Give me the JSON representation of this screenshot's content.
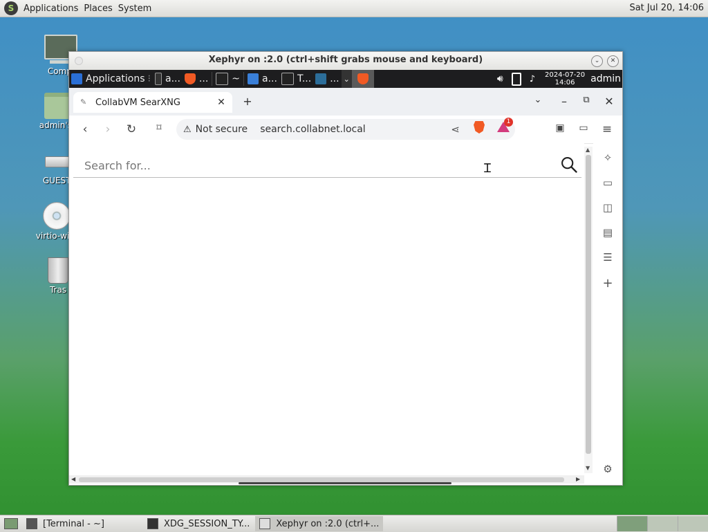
{
  "top_panel": {
    "menus": [
      "Applications",
      "Places",
      "System"
    ],
    "clock": "Sat Jul 20, 14:06"
  },
  "desktop_icons": [
    {
      "label": "Compi",
      "icon": "computer-icon"
    },
    {
      "label": "admin's I",
      "icon": "home-folder-icon"
    },
    {
      "label": "GUEST8",
      "icon": "drive-icon"
    },
    {
      "label": "virtio-win-",
      "icon": "disc-icon"
    },
    {
      "label": "Tras",
      "icon": "trash-icon"
    }
  ],
  "xephyr": {
    "title": "Xephyr on :2.0 (ctrl+shift grabs mouse and keyboard)"
  },
  "guest_panel": {
    "applications": "Applications",
    "tasks": [
      "a...",
      "...",
      "~",
      "a...",
      "T...",
      "..."
    ],
    "date": "2024-07-20",
    "time": "14:06",
    "user": "admin"
  },
  "browser": {
    "tab_title": "CollabVM SearXNG",
    "security_label": "Not secure",
    "url": "search.collabnet.local",
    "rewards_badge": "1"
  },
  "search": {
    "placeholder": "Search for...",
    "value": ""
  },
  "bottom_panel": {
    "tasks": [
      "[Terminal - ~]",
      "XDG_SESSION_TY...",
      "Xephyr on :2.0 (ctrl+..."
    ]
  }
}
